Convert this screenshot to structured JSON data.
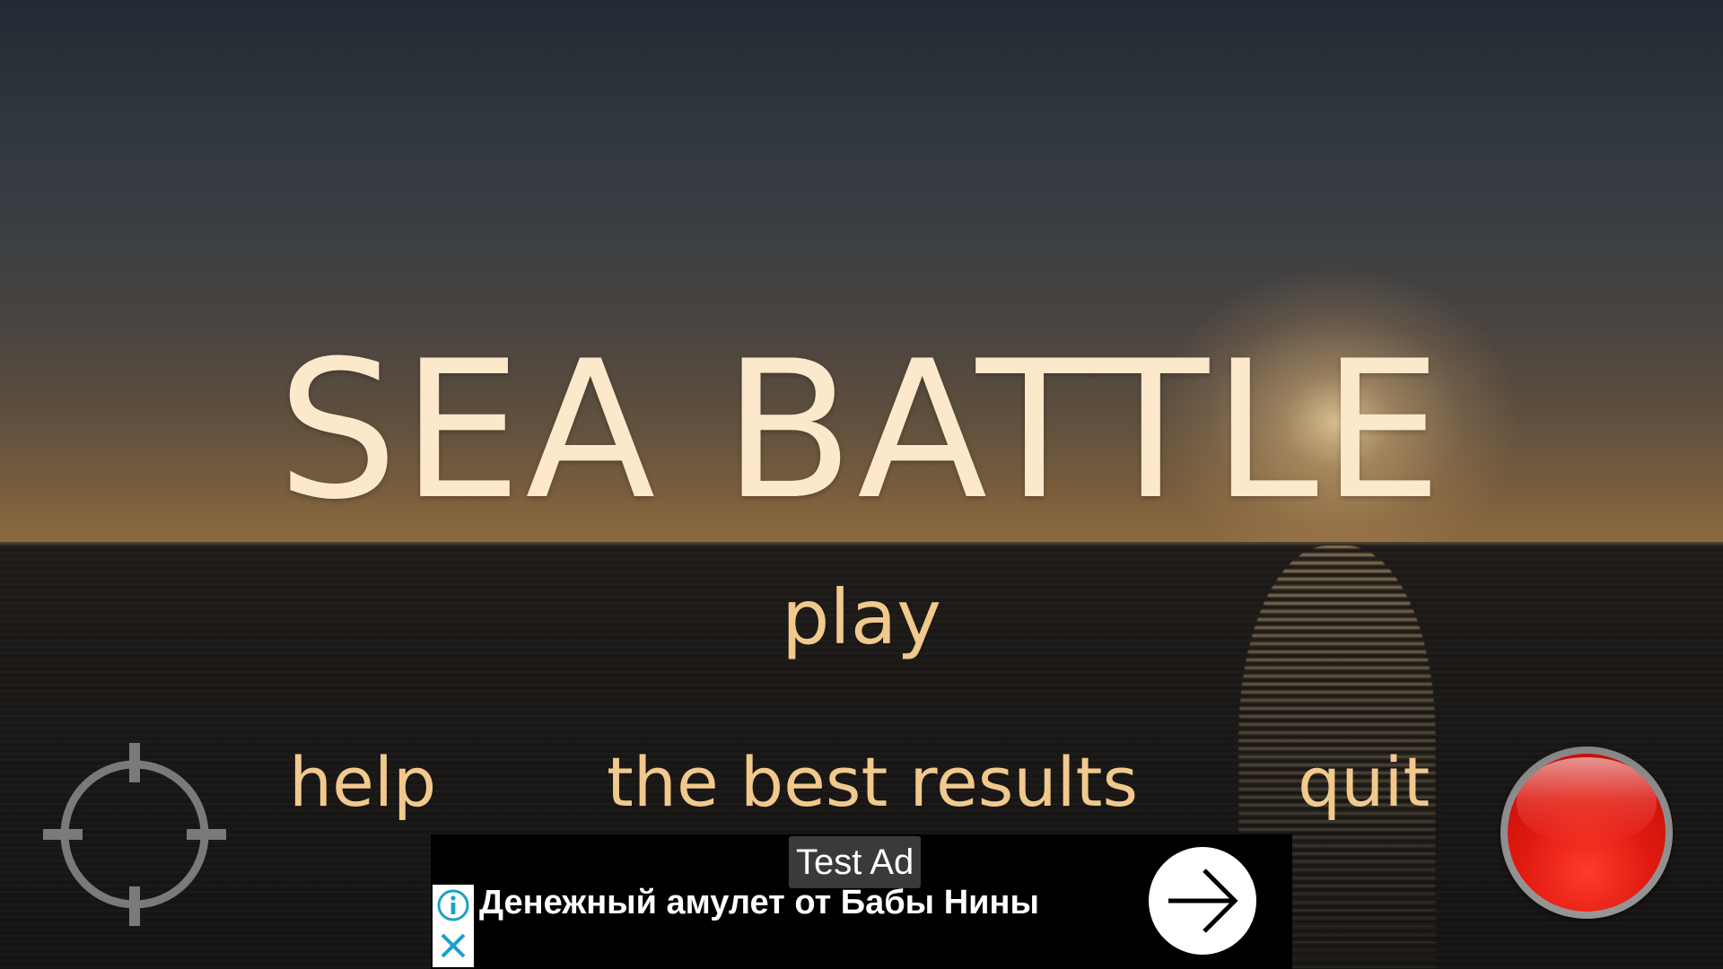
{
  "game": {
    "title": "SEA BATTLE",
    "colors": {
      "title": "#fce8cb",
      "menu": "#f1c98d"
    }
  },
  "menu": {
    "play": "play",
    "help": "help",
    "best_results": "the best results",
    "quit": "quit"
  },
  "controls": {
    "left_icon": "crosshair-icon",
    "right_icon": "red-record-button",
    "left_icon_color": "#7a7a7a",
    "right_icon_color": "#e01a10"
  },
  "ad": {
    "label": "Test Ad",
    "text": "Денежный амулет от Бабы Нины",
    "info_icon": "info-icon",
    "close_icon": "close-icon",
    "action_icon": "arrow-right-icon",
    "accent_color": "#1fa0c8"
  }
}
